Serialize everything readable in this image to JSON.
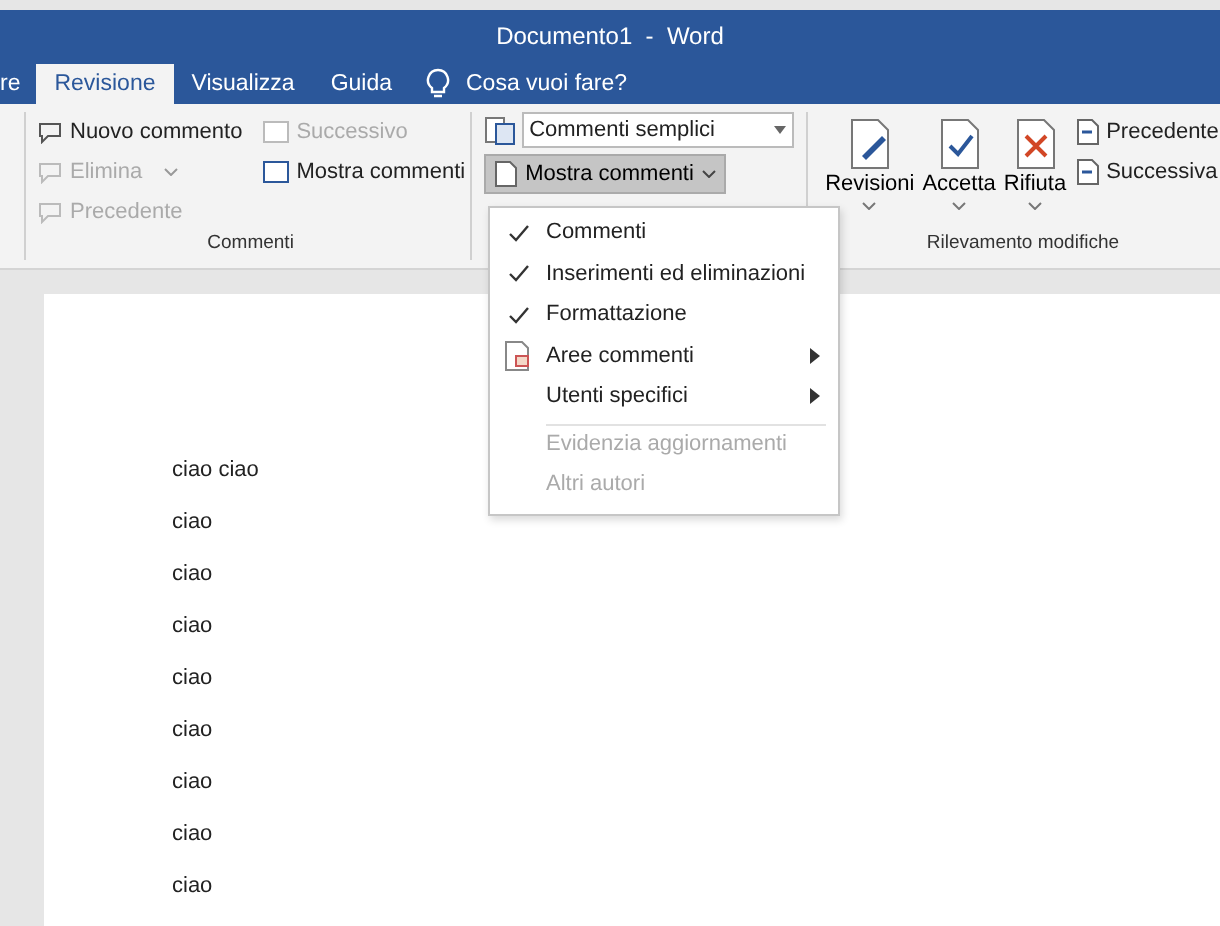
{
  "window": {
    "title": "Documento1  -  Word"
  },
  "tabs": [
    {
      "label": "re",
      "selected": false
    },
    {
      "label": "Revisione",
      "selected": true
    },
    {
      "label": "Visualizza",
      "selected": false
    },
    {
      "label": "Guida",
      "selected": false
    }
  ],
  "tell_me": {
    "placeholder": "Cosa vuoi fare?"
  },
  "comments_group": {
    "label": "Commenti",
    "buttons": [
      {
        "label": "Nuovo commento",
        "disabled": false
      },
      {
        "label": "Elimina",
        "disabled": true
      },
      {
        "label": "Precedente",
        "disabled": true
      },
      {
        "label": "Successivo",
        "disabled": true
      },
      {
        "label": "Mostra commenti",
        "disabled": false
      }
    ]
  },
  "markup_dropdown": {
    "value": "Commenti semplici"
  },
  "show_markup_button": {
    "label": "Mostra commenti",
    "expanded": true
  },
  "tracking_group": {
    "label": "Rilevamento modifiche",
    "big_buttons": [
      "Revisioni",
      "Accetta",
      "Rifiuta"
    ],
    "small_buttons": [
      "Precedente",
      "Successiva"
    ]
  },
  "menu": [
    {
      "label": "Commenti",
      "kind": "check",
      "checked": true,
      "disabled": false,
      "submenu": false,
      "divider_before": false
    },
    {
      "label": "Inserimenti ed eliminazioni",
      "kind": "check",
      "checked": true,
      "disabled": false,
      "submenu": false,
      "divider_before": false
    },
    {
      "label": "Formattazione",
      "kind": "check",
      "checked": true,
      "disabled": false,
      "submenu": false,
      "divider_before": false
    },
    {
      "label": "Aree commenti",
      "kind": "icon",
      "disabled": false,
      "submenu": true,
      "divider_before": false
    },
    {
      "label": "Utenti specifici",
      "kind": "check",
      "checked": false,
      "disabled": false,
      "submenu": true,
      "divider_before": false
    },
    {
      "label": "Evidenzia aggiornamenti",
      "kind": "check",
      "checked": false,
      "disabled": true,
      "submenu": false,
      "divider_before": true
    },
    {
      "label": "Altri autori",
      "kind": "check",
      "checked": false,
      "disabled": true,
      "submenu": false,
      "divider_before": false
    }
  ],
  "document": {
    "lines": [
      "ciao ciao",
      "ciao",
      "ciao",
      "ciao",
      "ciao",
      "ciao",
      "ciao",
      "ciao",
      "ciao"
    ]
  }
}
